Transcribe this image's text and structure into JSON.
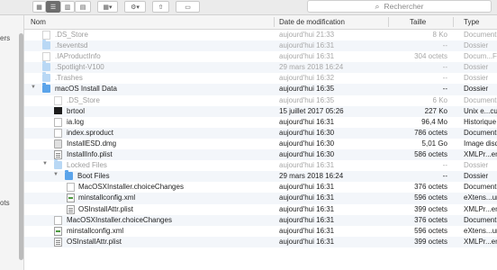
{
  "toolbar": {
    "view_buttons": [
      "icon-view",
      "list-view",
      "column-view",
      "gallery-view"
    ],
    "arrange_icon": "grid-arrange-icon",
    "action_icon": "gear-icon",
    "share_icon": "share-icon",
    "tag_icon": "tag-icon",
    "search_placeholder": "Rechercher"
  },
  "sidebar": {
    "partial_labels": [
      "ers",
      "ots"
    ]
  },
  "columns": {
    "name": "Nom",
    "date": "Date de modification",
    "size": "Taille",
    "type": "Type"
  },
  "rows": [
    {
      "name": ".DS_Store",
      "date": "aujourd'hui 21:33",
      "size": "8 Ko",
      "type": "Document"
    },
    {
      "name": ".fseventsd",
      "date": "aujourd'hui 16:31",
      "size": "--",
      "type": "Dossier"
    },
    {
      "name": ".IAProductInfo",
      "date": "aujourd'hui 16:31",
      "size": "304 octets",
      "type": "Docum...Fiend"
    },
    {
      "name": ".Spotlight-V100",
      "date": "29 mars 2018 16:24",
      "size": "--",
      "type": "Dossier"
    },
    {
      "name": ".Trashes",
      "date": "aujourd'hui 16:32",
      "size": "--",
      "type": "Dossier"
    },
    {
      "name": "macOS Install Data",
      "date": "aujourd'hui 16:35",
      "size": "--",
      "type": "Dossier"
    },
    {
      "name": ".DS_Store",
      "date": "aujourd'hui 16:35",
      "size": "6 Ko",
      "type": "Document"
    },
    {
      "name": "brtool",
      "date": "15 juillet 2017 05:26",
      "size": "227 Ko",
      "type": "Unix e...cutable"
    },
    {
      "name": "ia.log",
      "date": "aujourd'hui 16:31",
      "size": "96,4 Mo",
      "type": "Historique"
    },
    {
      "name": "index.sproduct",
      "date": "aujourd'hui 16:30",
      "size": "786 octets",
      "type": "Document"
    },
    {
      "name": "InstallESD.dmg",
      "date": "aujourd'hui 16:30",
      "size": "5,01 Go",
      "type": "Image disque"
    },
    {
      "name": "InstallInfo.plist",
      "date": "aujourd'hui 16:30",
      "size": "586 octets",
      "type": "XMLPr...ertyList"
    },
    {
      "name": "Locked Files",
      "date": "aujourd'hui 16:31",
      "size": "--",
      "type": "Dossier"
    },
    {
      "name": "Boot Files",
      "date": "29 mars 2018 16:24",
      "size": "--",
      "type": "Dossier"
    },
    {
      "name": "MacOSXInstaller.choiceChanges",
      "date": "aujourd'hui 16:31",
      "size": "376 octets",
      "type": "Document"
    },
    {
      "name": "minstallconfig.xml",
      "date": "aujourd'hui 16:31",
      "size": "596 octets",
      "type": "eXtens...ument"
    },
    {
      "name": "OSInstallAttr.plist",
      "date": "aujourd'hui 16:31",
      "size": "399 octets",
      "type": "XMLPr...ertyList"
    },
    {
      "name": "MacOSXInstaller.choiceChanges",
      "date": "aujourd'hui 16:31",
      "size": "376 octets",
      "type": "Document"
    },
    {
      "name": "minstallconfig.xml",
      "date": "aujourd'hui 16:31",
      "size": "596 octets",
      "type": "eXtens...ument"
    },
    {
      "name": "OSInstallAttr.plist",
      "date": "aujourd'hui 16:31",
      "size": "399 octets",
      "type": "XMLPr...ertyList"
    }
  ]
}
